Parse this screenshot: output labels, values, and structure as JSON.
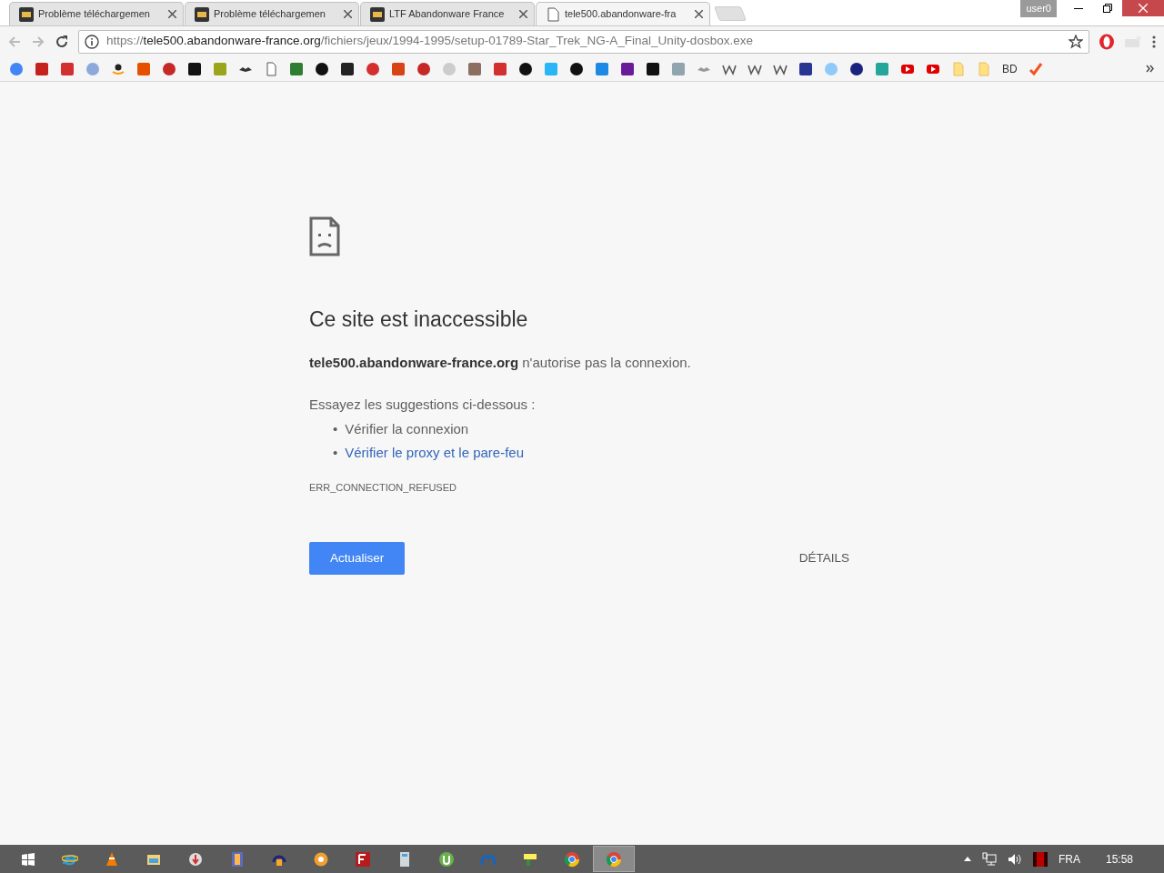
{
  "window": {
    "profile": "user0"
  },
  "tabs": [
    {
      "title": "Problème téléchargemen",
      "kind": "site",
      "selected": false
    },
    {
      "title": "Problème téléchargemen",
      "kind": "site",
      "selected": false
    },
    {
      "title": "LTF Abandonware France",
      "kind": "site",
      "selected": false
    },
    {
      "title": "tele500.abandonware-fra",
      "kind": "page",
      "selected": true
    }
  ],
  "address_bar": {
    "scheme": "https://",
    "host": "tele500.abandonware-france.org",
    "path": "/fichiers/jeux/1994-1995/setup-01789-Star_Trek_NG-A_Final_Unity-dosbox.exe"
  },
  "bookmarks": [
    {
      "kind": "icon"
    },
    {
      "kind": "icon"
    },
    {
      "kind": "icon"
    },
    {
      "kind": "icon"
    },
    {
      "kind": "icon"
    },
    {
      "kind": "icon"
    },
    {
      "kind": "icon"
    },
    {
      "kind": "icon"
    },
    {
      "kind": "icon"
    },
    {
      "kind": "icon"
    },
    {
      "kind": "icon"
    },
    {
      "kind": "icon"
    },
    {
      "kind": "icon"
    },
    {
      "kind": "icon"
    },
    {
      "kind": "icon"
    },
    {
      "kind": "icon"
    },
    {
      "kind": "icon"
    },
    {
      "kind": "icon"
    },
    {
      "kind": "icon"
    },
    {
      "kind": "icon"
    },
    {
      "kind": "icon"
    },
    {
      "kind": "icon"
    },
    {
      "kind": "icon"
    },
    {
      "kind": "icon"
    },
    {
      "kind": "icon"
    },
    {
      "kind": "icon"
    },
    {
      "kind": "icon"
    },
    {
      "kind": "icon"
    },
    {
      "kind": "icon"
    },
    {
      "kind": "icon"
    },
    {
      "kind": "icon"
    },
    {
      "kind": "icon"
    },
    {
      "kind": "icon"
    },
    {
      "kind": "icon"
    },
    {
      "kind": "icon"
    },
    {
      "kind": "icon"
    },
    {
      "kind": "icon"
    },
    {
      "kind": "icon"
    },
    {
      "kind": "icon"
    },
    {
      "kind": "label",
      "label": "BD"
    },
    {
      "kind": "icon"
    }
  ],
  "error_page": {
    "heading": "Ce site est inaccessible",
    "message": "**tele500.abandonware-france.org** n'autorise pas la connexion.",
    "suggestions_intro": "Essayez les suggestions ci-dessous :",
    "suggestions": [
      {
        "bullet": "•",
        "text": "Vérifier la connexion",
        "kind": "text"
      },
      {
        "bullet": "•",
        "text": "Vérifier le proxy et le pare-feu",
        "kind": "link"
      }
    ],
    "error_code": "ERR_CONNECTION_REFUSED",
    "reload_button": "Actualiser",
    "details_button": "DÉTAILS"
  },
  "taskbar": {
    "apps": [
      {
        "selected": false
      },
      {
        "selected": false
      },
      {
        "selected": false
      },
      {
        "selected": false
      },
      {
        "selected": false
      },
      {
        "selected": false
      },
      {
        "selected": false
      },
      {
        "selected": false
      },
      {
        "selected": false
      },
      {
        "selected": false
      },
      {
        "selected": false
      },
      {
        "selected": false
      },
      {
        "selected": false
      },
      {
        "selected": true
      }
    ],
    "language": "FRA",
    "time": "15:58"
  }
}
